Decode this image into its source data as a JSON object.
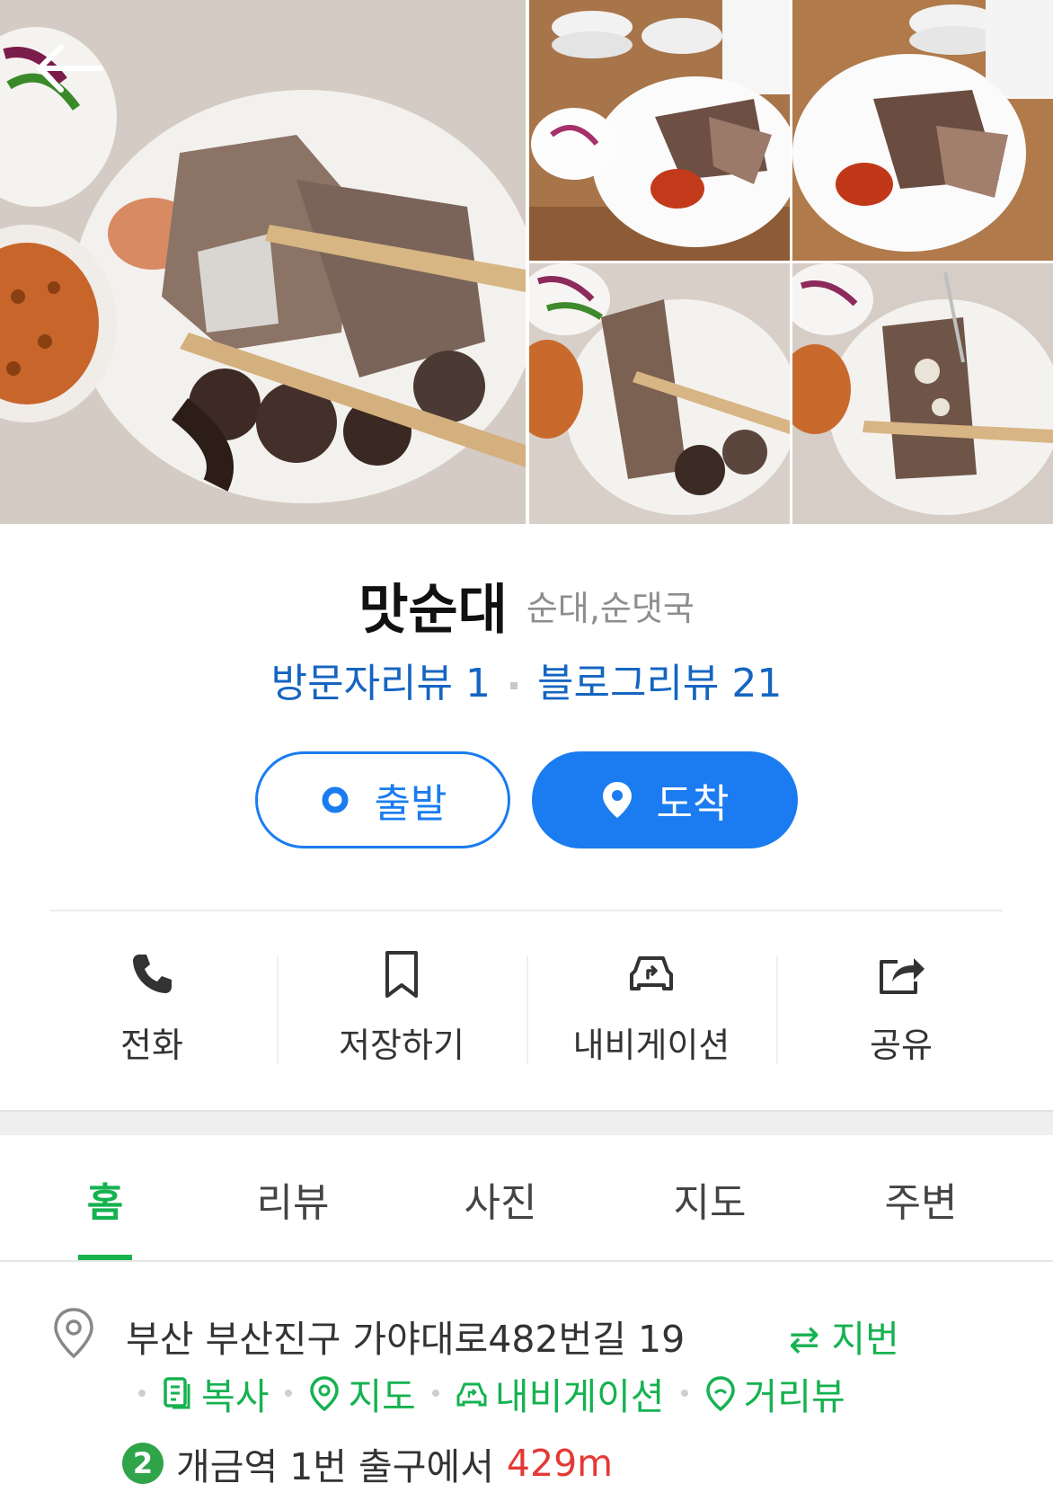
{
  "place": {
    "name": "맛순대",
    "category": "순대,순댓국"
  },
  "reviews": {
    "visitor": "방문자리뷰 1",
    "blog": "블로그리뷰 21"
  },
  "route": {
    "start_label": "출발",
    "arrive_label": "도착"
  },
  "actions": [
    {
      "label": "전화",
      "icon": "phone-icon"
    },
    {
      "label": "저장하기",
      "icon": "bookmark-icon"
    },
    {
      "label": "내비게이션",
      "icon": "car-icon"
    },
    {
      "label": "공유",
      "icon": "share-icon"
    }
  ],
  "tabs": [
    {
      "label": "홈",
      "active": true
    },
    {
      "label": "리뷰",
      "active": false
    },
    {
      "label": "사진",
      "active": false
    },
    {
      "label": "지도",
      "active": false
    },
    {
      "label": "주변",
      "active": false
    }
  ],
  "info": {
    "address": "부산 부산진구 가야대로482번길 19",
    "jibun_label": "⇄ 지번",
    "links": {
      "copy": "복사",
      "map": "지도",
      "navigation": "내비게이션",
      "street_view": "거리뷰"
    },
    "subway": {
      "line": "2",
      "text": "개금역 1번 출구에서",
      "distance": "429m"
    }
  },
  "colors": {
    "accent_blue": "#1a7cf0",
    "review_blue": "#1565c0",
    "naver_green": "#15b250",
    "distance_red": "#e53935",
    "line2_green": "#2fa448"
  }
}
